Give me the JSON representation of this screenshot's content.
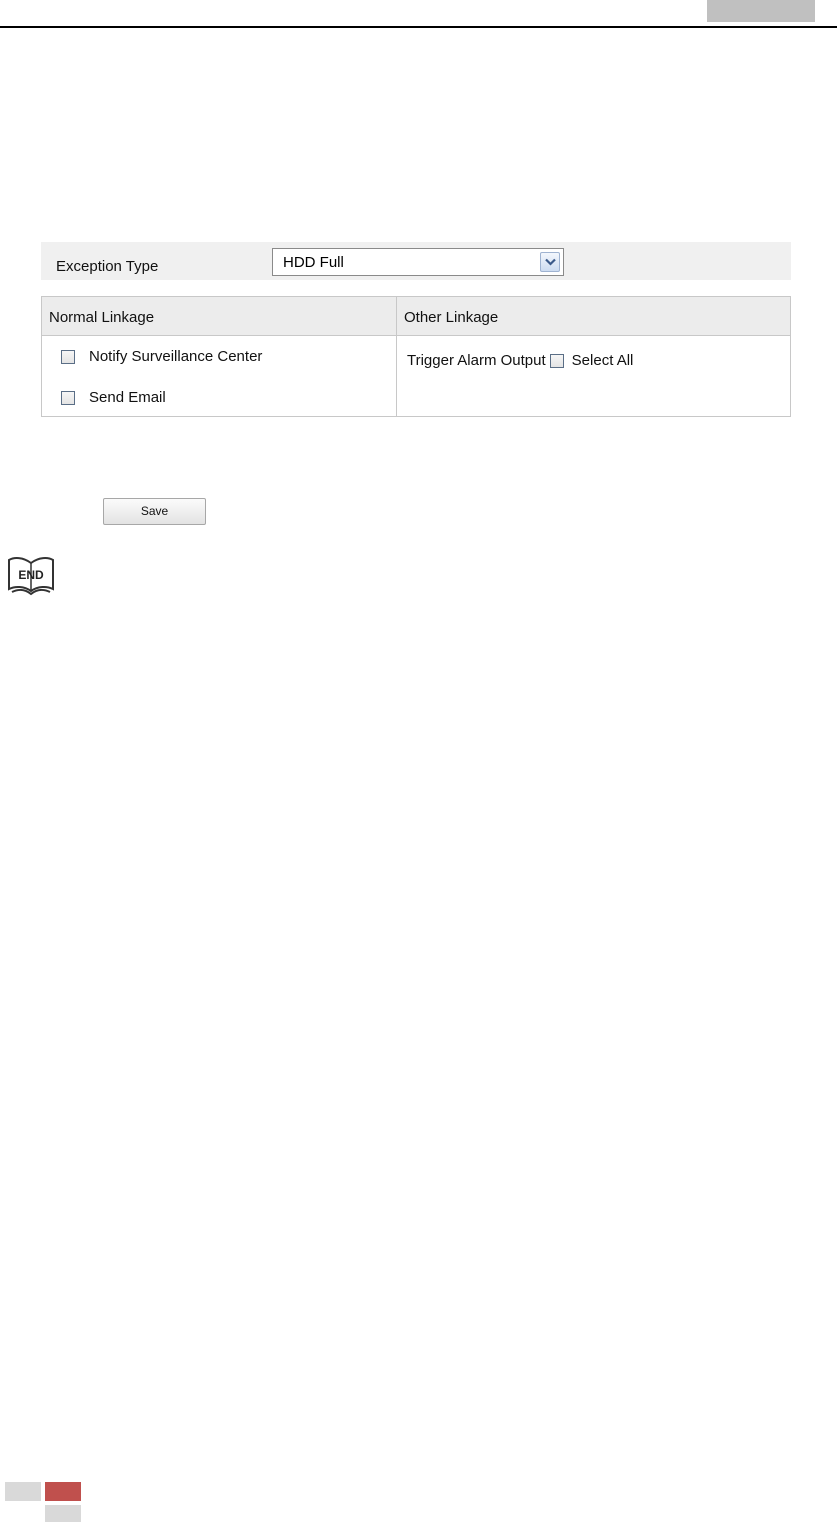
{
  "exception": {
    "label": "Exception Type",
    "selected": "HDD Full"
  },
  "linkage": {
    "normal": {
      "header": "Normal Linkage",
      "options": [
        "Notify Surveillance Center",
        "Send Email"
      ]
    },
    "other": {
      "header": "Other Linkage",
      "trigger_label": "Trigger Alarm Output",
      "select_all_label": "Select All"
    }
  },
  "save_label": "Save",
  "end_icon_text": "END",
  "colors": {
    "header_tab": "#c0c0c0",
    "footer_red": "#c0504d",
    "footer_gray": "#d9d9d9"
  }
}
